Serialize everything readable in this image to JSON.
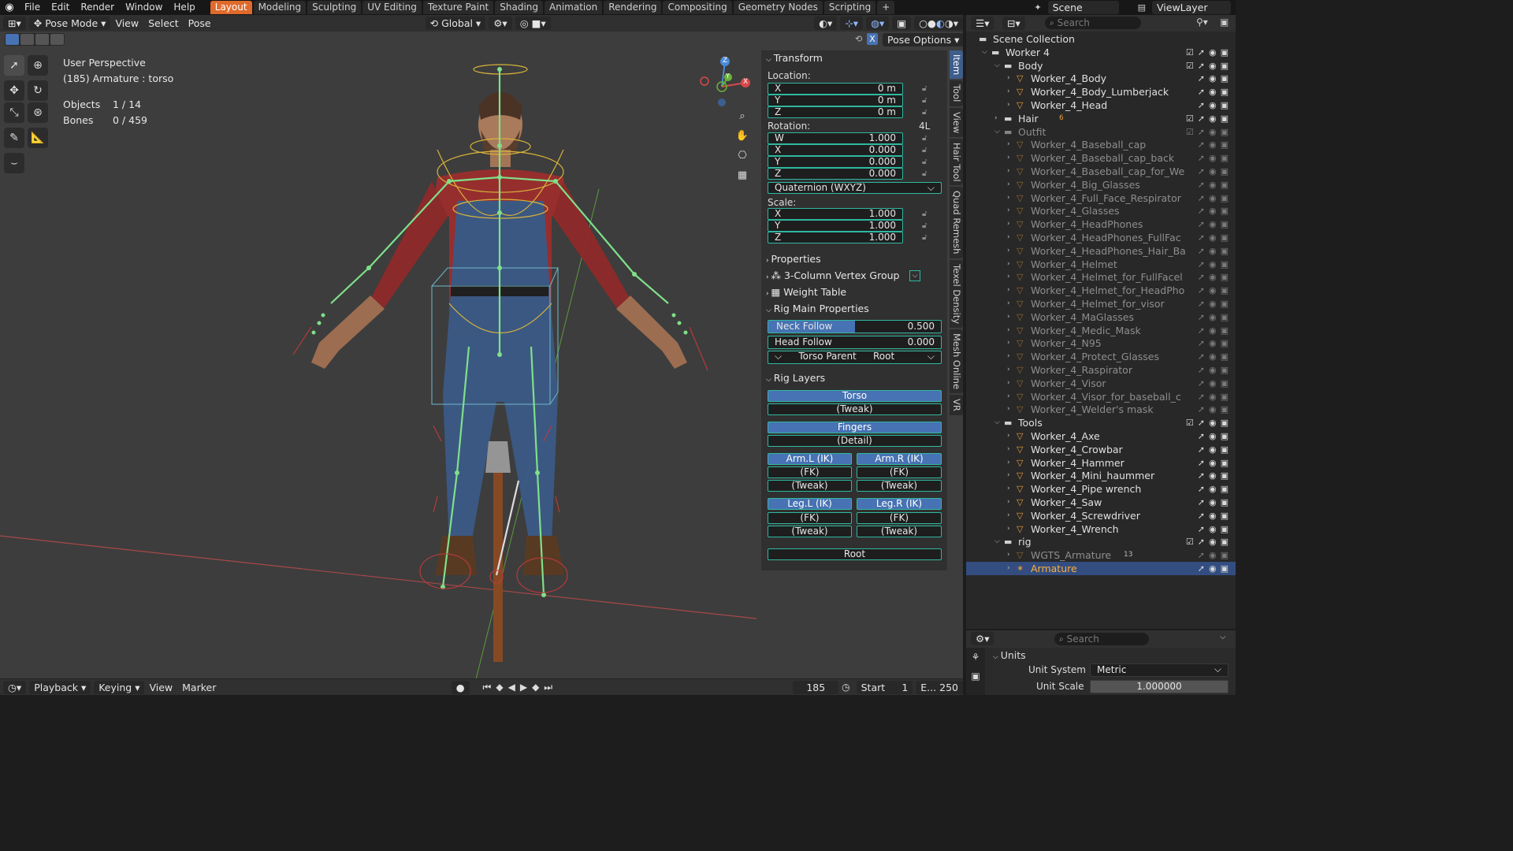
{
  "menu": {
    "items": [
      "File",
      "Edit",
      "Render",
      "Window",
      "Help"
    ],
    "workspaces": [
      "Layout",
      "Modeling",
      "Sculpting",
      "UV Editing",
      "Texture Paint",
      "Shading",
      "Animation",
      "Rendering",
      "Compositing",
      "Geometry Nodes",
      "Scripting"
    ],
    "active_workspace": "Layout",
    "add_tab": "+",
    "scene": "Scene",
    "view_layer": "ViewLayer"
  },
  "viewport_header": {
    "mode": "Pose Mode",
    "menus": [
      "View",
      "Select",
      "Pose"
    ],
    "orientation": "Global",
    "pose_options": "Pose Options"
  },
  "viewport": {
    "perspective": "User Perspective",
    "active": "(185) Armature : torso",
    "objects_label": "Objects",
    "objects_value": "1 / 14",
    "bones_label": "Bones",
    "bones_value": "0 / 459",
    "gizmo": {
      "x": "X",
      "y": "Y",
      "z": "Z"
    }
  },
  "transform": {
    "title": "Transform",
    "location_label": "Location:",
    "location": [
      {
        "axis": "X",
        "value": "0 m"
      },
      {
        "axis": "Y",
        "value": "0 m"
      },
      {
        "axis": "Z",
        "value": "0 m"
      }
    ],
    "rotation_label": "Rotation:",
    "rotation_extra": "4L",
    "rotation": [
      {
        "axis": "W",
        "value": "1.000"
      },
      {
        "axis": "X",
        "value": "0.000"
      },
      {
        "axis": "Y",
        "value": "0.000"
      },
      {
        "axis": "Z",
        "value": "0.000"
      }
    ],
    "rotation_mode": "Quaternion (WXYZ)",
    "scale_label": "Scale:",
    "scale": [
      {
        "axis": "X",
        "value": "1.000"
      },
      {
        "axis": "Y",
        "value": "1.000"
      },
      {
        "axis": "Z",
        "value": "1.000"
      }
    ]
  },
  "panels": {
    "properties": "Properties",
    "vertex_group": "3-Column Vertex Group",
    "weight_table": "Weight Table",
    "rig_main": "Rig Main Properties",
    "neck_follow_label": "Neck Follow",
    "neck_follow_value": "0.500",
    "neck_follow_fraction": 0.5,
    "head_follow_label": "Head Follow",
    "head_follow_value": "0.000",
    "torso_parent_label": "Torso Parent",
    "torso_parent_value": "Root",
    "rig_layers": "Rig Layers"
  },
  "rig_layers": {
    "torso": "Torso",
    "torso_tweak": "(Tweak)",
    "fingers": "Fingers",
    "fingers_detail": "(Detail)",
    "arm_l_ik": "Arm.L (IK)",
    "arm_r_ik": "Arm.R (IK)",
    "arm_l_fk": "(FK)",
    "arm_r_fk": "(FK)",
    "arm_l_tweak": "(Tweak)",
    "arm_r_tweak": "(Tweak)",
    "leg_l_ik": "Leg.L (IK)",
    "leg_r_ik": "Leg.R (IK)",
    "leg_l_fk": "(FK)",
    "leg_r_fk": "(FK)",
    "leg_l_tweak": "(Tweak)",
    "leg_r_tweak": "(Tweak)",
    "root": "Root"
  },
  "side_tabs": [
    "Item",
    "Tool",
    "View",
    "Hair Tool",
    "Quad Remesh",
    "Texel Density",
    "Mesh Online",
    "VR"
  ],
  "outliner": {
    "search_placeholder": "Search",
    "rows": [
      {
        "name": "Scene Collection",
        "depth": 0,
        "kind": "scene"
      },
      {
        "name": "Worker 4",
        "depth": 1,
        "kind": "collection"
      },
      {
        "name": "Body",
        "depth": 2,
        "kind": "collection"
      },
      {
        "name": "Worker_4_Body",
        "depth": 3,
        "kind": "object"
      },
      {
        "name": "Worker_4_Body_Lumberjack",
        "depth": 3,
        "kind": "object"
      },
      {
        "name": "Worker_4_Head",
        "depth": 3,
        "kind": "object"
      },
      {
        "name": "Hair",
        "depth": 2,
        "kind": "collection"
      },
      {
        "name": "Outfit",
        "depth": 2,
        "kind": "collection-dim"
      },
      {
        "name": "Worker_4_Baseball_cap",
        "depth": 3,
        "kind": "object-dim"
      },
      {
        "name": "Worker_4_Baseball_cap_back",
        "depth": 3,
        "kind": "object-dim"
      },
      {
        "name": "Worker_4_Baseball_cap_for_We",
        "depth": 3,
        "kind": "object-dim"
      },
      {
        "name": "Worker_4_Big_Glasses",
        "depth": 3,
        "kind": "object-dim"
      },
      {
        "name": "Worker_4_Full_Face_Respirator",
        "depth": 3,
        "kind": "object-dim"
      },
      {
        "name": "Worker_4_Glasses",
        "depth": 3,
        "kind": "object-dim"
      },
      {
        "name": "Worker_4_HeadPhones",
        "depth": 3,
        "kind": "object-dim"
      },
      {
        "name": "Worker_4_HeadPhones_FullFac",
        "depth": 3,
        "kind": "object-dim"
      },
      {
        "name": "Worker_4_HeadPhones_Hair_Ba",
        "depth": 3,
        "kind": "object-dim"
      },
      {
        "name": "Worker_4_Helmet",
        "depth": 3,
        "kind": "object-dim"
      },
      {
        "name": "Worker_4_Helmet_for_FullFacel",
        "depth": 3,
        "kind": "object-dim"
      },
      {
        "name": "Worker_4_Helmet_for_HeadPho",
        "depth": 3,
        "kind": "object-dim"
      },
      {
        "name": "Worker_4_Helmet_for_visor",
        "depth": 3,
        "kind": "object-dim"
      },
      {
        "name": "Worker_4_MaGlasses",
        "depth": 3,
        "kind": "object-dim"
      },
      {
        "name": "Worker_4_Medic_Mask",
        "depth": 3,
        "kind": "object-dim"
      },
      {
        "name": "Worker_4_N95",
        "depth": 3,
        "kind": "object-dim"
      },
      {
        "name": "Worker_4_Protect_Glasses",
        "depth": 3,
        "kind": "object-dim"
      },
      {
        "name": "Worker_4_Raspirator",
        "depth": 3,
        "kind": "object-dim"
      },
      {
        "name": "Worker_4_Visor",
        "depth": 3,
        "kind": "object-dim"
      },
      {
        "name": "Worker_4_Visor_for_baseball_c",
        "depth": 3,
        "kind": "object-dim"
      },
      {
        "name": "Worker_4_Welder's mask",
        "depth": 3,
        "kind": "object-dim"
      },
      {
        "name": "Tools",
        "depth": 2,
        "kind": "collection"
      },
      {
        "name": "Worker_4_Axe",
        "depth": 3,
        "kind": "object"
      },
      {
        "name": "Worker_4_Crowbar",
        "depth": 3,
        "kind": "object"
      },
      {
        "name": "Worker_4_Hammer",
        "depth": 3,
        "kind": "object"
      },
      {
        "name": "Worker_4_Mini_haummer",
        "depth": 3,
        "kind": "object"
      },
      {
        "name": "Worker_4_Pipe wrench",
        "depth": 3,
        "kind": "object"
      },
      {
        "name": "Worker_4_Saw",
        "depth": 3,
        "kind": "object"
      },
      {
        "name": "Worker_4_Screwdriver",
        "depth": 3,
        "kind": "object"
      },
      {
        "name": "Worker_4_Wrench",
        "depth": 3,
        "kind": "object"
      },
      {
        "name": "rig",
        "depth": 2,
        "kind": "collection"
      },
      {
        "name": "WGTS_Armature",
        "depth": 3,
        "kind": "object-dim"
      },
      {
        "name": "Armature",
        "depth": 3,
        "kind": "armature-selected"
      }
    ],
    "hair_badge": "6",
    "wgts_badge": "13"
  },
  "properties_editor": {
    "search_placeholder": "Search",
    "section": "Units",
    "unit_system_label": "Unit System",
    "unit_system_value": "Metric",
    "unit_scale_label": "Unit Scale",
    "unit_scale_value": "1.000000"
  },
  "timeline": {
    "playback": "Playback",
    "keying": "Keying",
    "view": "View",
    "marker": "Marker",
    "current_frame": "185",
    "start_label": "Start",
    "start_value": "1",
    "end_label": "E...",
    "end_value": "250"
  },
  "colors": {
    "accent_blue": "#4772b3",
    "active_tab": "#e06a2b",
    "bone_green": "#7fe08a",
    "widget_yellow": "#d8b33a",
    "teal_outline": "#2fb8a0"
  }
}
